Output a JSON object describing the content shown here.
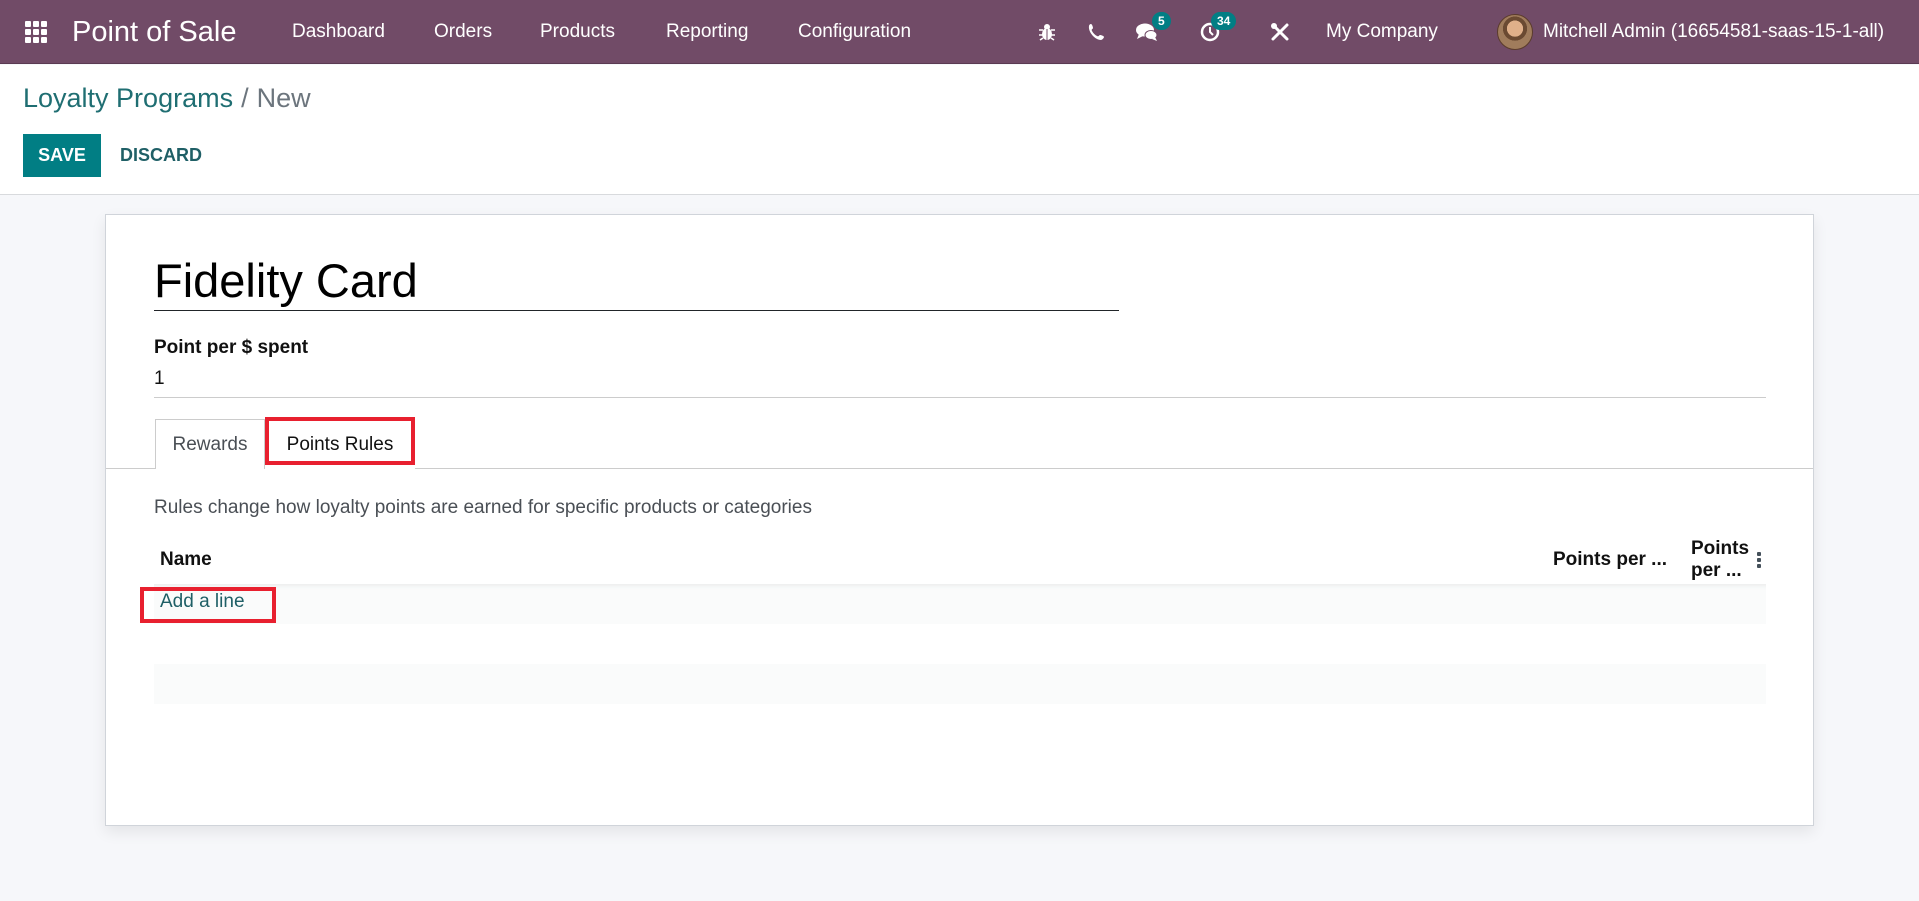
{
  "navbar": {
    "app_icon": "apps-grid-icon",
    "brand": "Point of Sale",
    "menu": [
      "Dashboard",
      "Orders",
      "Products",
      "Reporting",
      "Configuration"
    ],
    "systray": {
      "debug_icon": "bug-icon",
      "phone_icon": "phone-icon",
      "messages_icon": "chat-icon",
      "messages_count": "5",
      "activities_icon": "clock-icon",
      "activities_count": "34",
      "settings_icon": "tools-icon",
      "company": "My Company",
      "user": "Mitchell Admin (16654581-saas-15-1-all)"
    }
  },
  "control_panel": {
    "breadcrumb": {
      "parent": "Loyalty Programs",
      "separator": "/",
      "current": "New"
    },
    "save_label": "SAVE",
    "discard_label": "DISCARD"
  },
  "form": {
    "name": "Fidelity Card",
    "point_label": "Point per $ spent",
    "point_value": "1",
    "tabs": [
      {
        "label": "Rewards",
        "active": false
      },
      {
        "label": "Points Rules",
        "active": true,
        "highlighted": true
      }
    ],
    "help_text": "Rules change how loyalty points are earned for specific products or categories",
    "table": {
      "columns": [
        "Name",
        "Points per ...",
        "Points per ..."
      ],
      "add_line_label": "Add a line",
      "rows": []
    }
  },
  "colors": {
    "navbar": "#714b67",
    "primary": "#017e84",
    "highlight": "#e8202f"
  }
}
